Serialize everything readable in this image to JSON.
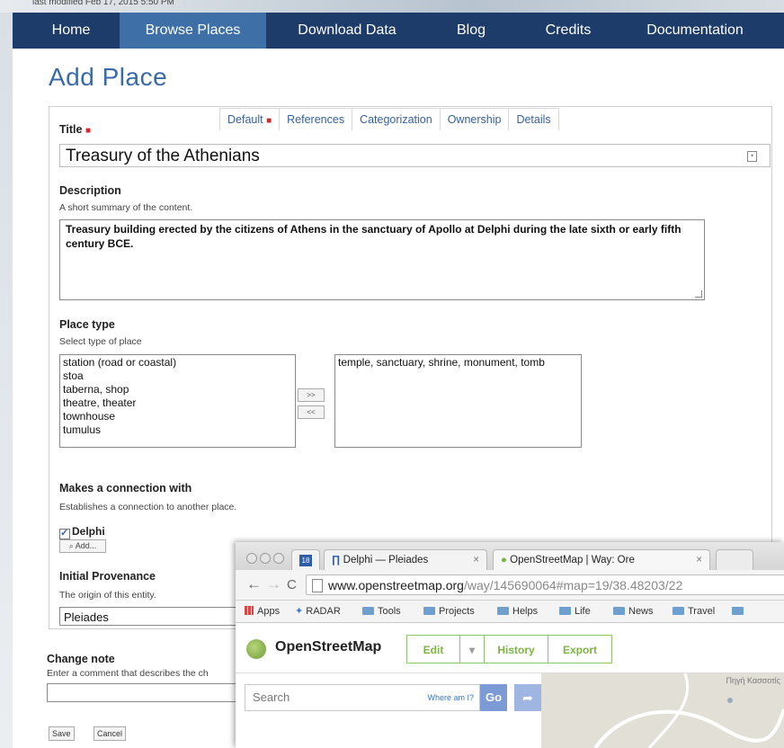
{
  "bg_window": {
    "text": "last modified Feb 17, 2015 5:50 PM"
  },
  "nav": [
    {
      "label": "Home"
    },
    {
      "label": "Browse Places"
    },
    {
      "label": "Download Data"
    },
    {
      "label": "Blog"
    },
    {
      "label": "Credits"
    },
    {
      "label": "Documentation"
    }
  ],
  "page_title": "Add Place",
  "tabs": [
    {
      "label": "Default"
    },
    {
      "label": "References"
    },
    {
      "label": "Categorization"
    },
    {
      "label": "Ownership"
    },
    {
      "label": "Details"
    }
  ],
  "title_field": {
    "label": "Title",
    "value": "Treasury of the Athenians"
  },
  "description": {
    "label": "Description",
    "help": "A short summary of the content.",
    "value": "Treasury building erected by the citizens of Athens in the sanctuary of Apollo at Delphi during the late sixth or early fifth century BCE."
  },
  "place_type": {
    "label": "Place type",
    "help": "Select type of place",
    "available": [
      "station (road or coastal)",
      "stoa",
      "taberna, shop",
      "theatre, theater",
      "townhouse",
      "tumulus"
    ],
    "selected": [
      "temple, sanctuary, shrine, monument, tomb"
    ],
    "add_label": ">>",
    "remove_label": "<<"
  },
  "connection": {
    "label": "Makes a connection with",
    "help": "Establishes a connection to another place.",
    "item": "Delphi",
    "add_label": "Add..."
  },
  "provenance": {
    "label": "Initial Provenance",
    "help": "The origin of this entity.",
    "value": "Pleiades"
  },
  "change_note": {
    "label": "Change note",
    "help": "Enter a comment that describes the ch"
  },
  "buttons": {
    "save": "Save",
    "cancel": "Cancel"
  },
  "browser": {
    "tabs": [
      {
        "label": "Delphi — Pleiades"
      },
      {
        "label": "OpenStreetMap | Way: Ore"
      }
    ],
    "calendar_label": "18",
    "url_host": "www.openstreetmap.org",
    "url_path": "/way/145690064#map=19/38.48203/22",
    "bookmarks": [
      "Apps",
      "RADAR",
      "Tools",
      "Projects",
      "Helps",
      "Life",
      "News",
      "Travel"
    ],
    "osm": {
      "name": "OpenStreetMap",
      "edit": "Edit",
      "history": "History",
      "export": "Export",
      "search_placeholder": "Search",
      "where_am_i": "Where am I?",
      "go": "Go",
      "map_label": "Πηγή Κασσοτίς"
    }
  }
}
